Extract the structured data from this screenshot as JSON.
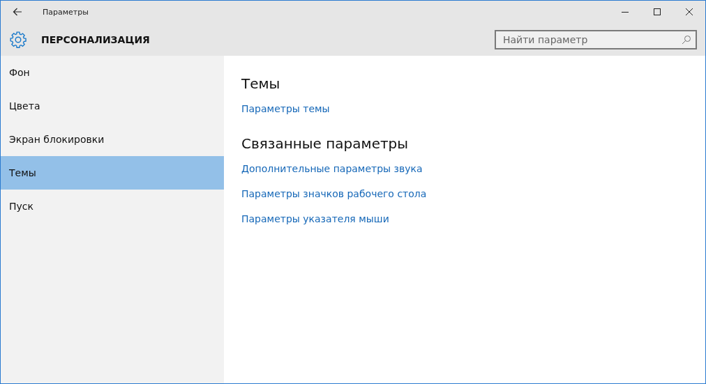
{
  "window": {
    "title": "Параметры"
  },
  "header": {
    "title": "ПЕРСОНАЛИЗАЦИЯ"
  },
  "search": {
    "placeholder": "Найти параметр"
  },
  "sidebar": {
    "items": [
      {
        "label": "Фон",
        "selected": false
      },
      {
        "label": "Цвета",
        "selected": false
      },
      {
        "label": "Экран блокировки",
        "selected": false
      },
      {
        "label": "Темы",
        "selected": true
      },
      {
        "label": "Пуск",
        "selected": false
      }
    ]
  },
  "sections": [
    {
      "heading": "Темы",
      "links": [
        "Параметры темы"
      ]
    },
    {
      "heading": "Связанные параметры",
      "links": [
        "Дополнительные параметры звука",
        "Параметры значков рабочего стола",
        "Параметры указателя мыши"
      ]
    }
  ]
}
